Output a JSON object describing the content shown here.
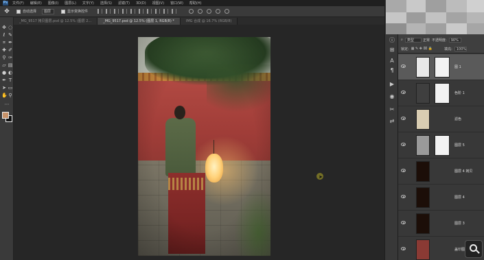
{
  "menubar": {
    "logo": "Ps",
    "items": [
      "文件(F)",
      "编辑(E)",
      "图像(I)",
      "图层(L)",
      "文字(Y)",
      "选择(S)",
      "滤镜(T)",
      "3D(D)",
      "视图(V)",
      "窗口(W)",
      "帮助(H)"
    ]
  },
  "options": {
    "move_icon": "move-tool-icon",
    "auto_select_label": "自动选择",
    "auto_select_value": "图层",
    "show_transform_label": "显示变换控件"
  },
  "tabs": [
    {
      "label": "_MG_9517 拷贝图层.psd @ 12.5% (图层 2...",
      "active": false
    },
    {
      "label": "_MG_9517.psd @ 12.5% (图层 1, RGB/8) *",
      "active": true
    },
    {
      "label": "IMG 合成 @ 16.7% (RGB/8)",
      "active": false
    }
  ],
  "toolbar": {
    "fg_color": "#c8936a",
    "bg_color": "#111111"
  },
  "layers_panel": {
    "kind_label": "类型",
    "blend_mode": "正常",
    "opacity_label": "不透明度:",
    "opacity_value": "90%",
    "lock_label": "锁定:",
    "fill_label": "填充:",
    "fill_value": "100%",
    "layers": [
      {
        "name": "图 1",
        "thumb_color": "#e8e8e8",
        "selected": true,
        "has_mask": true
      },
      {
        "name": "色阶 1",
        "thumb_color": "#3f3f3f",
        "selected": false,
        "has_mask": true
      },
      {
        "name": "滤色",
        "thumb_color": "#d9cdb2",
        "selected": false,
        "has_mask": false
      },
      {
        "name": "图层 5",
        "thumb_color": "#9a9a9a",
        "selected": false,
        "has_mask": true
      },
      {
        "name": "图层 4 拷贝",
        "thumb_color": "#1c0e08",
        "selected": false,
        "has_mask": false
      },
      {
        "name": "图层 4",
        "thumb_color": "#1c0e08",
        "selected": false,
        "has_mask": false
      },
      {
        "name": "图层 3",
        "thumb_color": "#1c0e08",
        "selected": false,
        "has_mask": false
      },
      {
        "name": "盖印图层（合并）",
        "thumb_color": "#8a3a34",
        "selected": false,
        "has_mask": false
      }
    ]
  }
}
